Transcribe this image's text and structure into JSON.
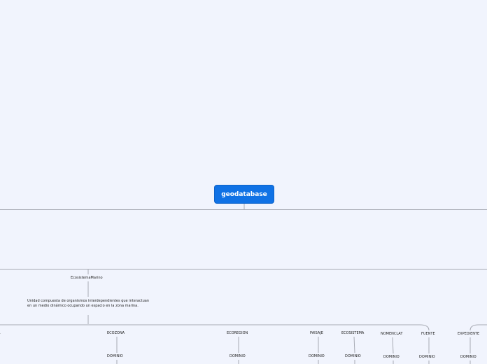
{
  "root": {
    "label": "geodatabase"
  },
  "marine_branch": {
    "name": "EcosistemaMarino",
    "description": "Unidad compuesta de organismos interdependientes que interactuan en un medio dinámico ocupando un espacio en la zona marina."
  },
  "entities": [
    {
      "name": "A",
      "child": ""
    },
    {
      "name": "ECOZONA",
      "child": "DOMINIO"
    },
    {
      "name": "ECOREGION",
      "child": "DOMINIO"
    },
    {
      "name": "PAISAJE",
      "child": "DOMINIO"
    },
    {
      "name": "ECOSISTEMA",
      "child": "DOMINIO"
    },
    {
      "name": "NOMENCLAT",
      "child": "DOMINIO"
    },
    {
      "name": "FUENTE",
      "child": "DOMINIO"
    },
    {
      "name": "EXPEDIENTE",
      "child": "DOMINIO"
    }
  ],
  "colors": {
    "background": "#f1f4fd",
    "root_fill": "#1072e5",
    "connector": "#a7aab3"
  }
}
